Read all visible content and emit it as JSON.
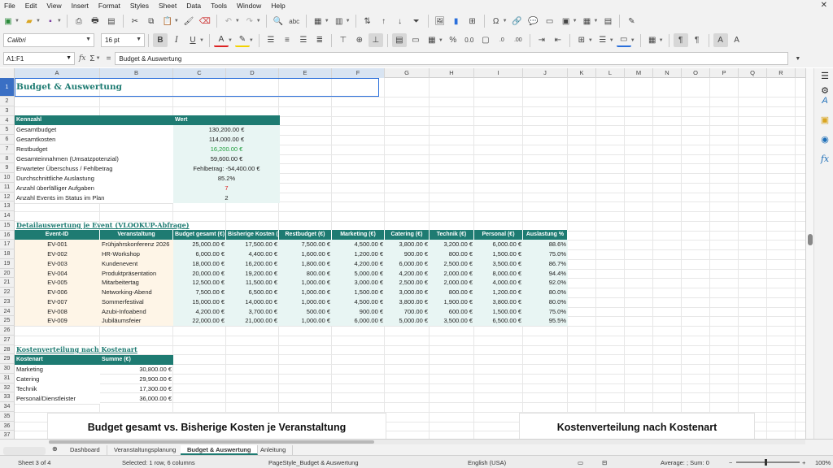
{
  "menu": [
    "File",
    "Edit",
    "View",
    "Insert",
    "Format",
    "Styles",
    "Sheet",
    "Data",
    "Tools",
    "Window",
    "Help"
  ],
  "font_name": "Calibri",
  "font_size": "16 pt",
  "name_box": "A1:F1",
  "formula": "Budget & Auswertung",
  "columns": [
    "A",
    "B",
    "C",
    "D",
    "E",
    "F",
    "G",
    "H",
    "I",
    "J",
    "K",
    "L",
    "M",
    "N",
    "O",
    "P",
    "Q",
    "R"
  ],
  "rows": [
    "1",
    "2",
    "3",
    "4",
    "5",
    "6",
    "7",
    "8",
    "9",
    "10",
    "11",
    "12",
    "13",
    "14",
    "15",
    "16",
    "17",
    "18",
    "19",
    "20",
    "21",
    "22",
    "23",
    "24",
    "25",
    "26",
    "27",
    "28",
    "29",
    "30",
    "31",
    "32",
    "33",
    "34",
    "35",
    "36",
    "37"
  ],
  "title": "Budget & Auswertung",
  "kpi": {
    "header": [
      "Kennzahl",
      "Wert"
    ],
    "rows": [
      {
        "label": "Gesamtbudget",
        "value": "130,200.00 €"
      },
      {
        "label": "Gesamtkosten",
        "value": "114,000.00 €"
      },
      {
        "label": "Restbudget",
        "value": "16,200.00 €"
      },
      {
        "label": "Gesamteinnahmen (Umsatzpotenzial)",
        "value": "59,600.00 €"
      },
      {
        "label": "Erwarteter Überschuss / Fehlbetrag",
        "value": "Fehlbetrag: -54,400.00 €"
      },
      {
        "label": "Durchschnittliche Auslastung",
        "value": "85.2%"
      },
      {
        "label": "Anzahl überfälliger Aufgaben",
        "value": "7"
      },
      {
        "label": "Anzahl Events im Status im Plan",
        "value": "2"
      }
    ]
  },
  "detail": {
    "title": "Detailauswertung je Event (VLOOKUP-Abfrage)",
    "header": [
      "Event-ID",
      "Veranstaltung",
      "Budget gesamt (€)",
      "Bisherige Kosten (",
      "Restbudget (€)",
      "Marketing (€)",
      "Catering (€)",
      "Technik (€)",
      "Personal (€)",
      "Auslastung %"
    ],
    "rows": [
      [
        "EV-001",
        "Frühjahrskonferenz 2026",
        "25,000.00 €",
        "17,500.00 €",
        "7,500.00 €",
        "4,500.00 €",
        "3,800.00 €",
        "3,200.00 €",
        "6,000.00 €",
        "88.6%"
      ],
      [
        "EV-002",
        "HR-Workshop",
        "6,000.00 €",
        "4,400.00 €",
        "1,600.00 €",
        "1,200.00 €",
        "900.00 €",
        "800.00 €",
        "1,500.00 €",
        "75.0%"
      ],
      [
        "EV-003",
        "Kundenevent",
        "18,000.00 €",
        "16,200.00 €",
        "1,800.00 €",
        "4,200.00 €",
        "6,000.00 €",
        "2,500.00 €",
        "3,500.00 €",
        "86.7%"
      ],
      [
        "EV-004",
        "Produktpräsentation",
        "20,000.00 €",
        "19,200.00 €",
        "800.00 €",
        "5,000.00 €",
        "4,200.00 €",
        "2,000.00 €",
        "8,000.00 €",
        "94.4%"
      ],
      [
        "EV-005",
        "Mitarbeitertag",
        "12,500.00 €",
        "11,500.00 €",
        "1,000.00 €",
        "3,000.00 €",
        "2,500.00 €",
        "2,000.00 €",
        "4,000.00 €",
        "92.0%"
      ],
      [
        "EV-006",
        "Networking-Abend",
        "7,500.00 €",
        "6,500.00 €",
        "1,000.00 €",
        "1,500.00 €",
        "3,000.00 €",
        "800.00 €",
        "1,200.00 €",
        "80.0%"
      ],
      [
        "EV-007",
        "Sommerfestival",
        "15,000.00 €",
        "14,000.00 €",
        "1,000.00 €",
        "4,500.00 €",
        "3,800.00 €",
        "1,900.00 €",
        "3,800.00 €",
        "80.0%"
      ],
      [
        "EV-008",
        "Azubi-Infoabend",
        "4,200.00 €",
        "3,700.00 €",
        "500.00 €",
        "900.00 €",
        "700.00 €",
        "600.00 €",
        "1,500.00 €",
        "75.0%"
      ],
      [
        "EV-009",
        "Jubiläumsfeier",
        "22,000.00 €",
        "21,000.00 €",
        "1,000.00 €",
        "6,000.00 €",
        "5,000.00 €",
        "3,500.00 €",
        "6,500.00 €",
        "95.5%"
      ]
    ]
  },
  "cost": {
    "title": "Kostenverteilung nach Kostenart",
    "header": [
      "Kostenart",
      "Summe (€)"
    ],
    "rows": [
      [
        "Marketing",
        "30,800.00 €"
      ],
      [
        "Catering",
        "29,900.00 €"
      ],
      [
        "Technik",
        "17,300.00 €"
      ],
      [
        "Personal/Dienstleister",
        "36,000.00 €"
      ]
    ]
  },
  "charts": {
    "left_title": "Budget gesamt vs. Bisherige Kosten je Veranstaltung",
    "right_title": "Kostenverteilung nach Kostenart"
  },
  "tabs": [
    "Dashboard",
    "Veranstaltungsplanung",
    "Budget & Auswertung",
    "Anleitung"
  ],
  "active_tab": "Budget & Auswertung",
  "status": {
    "sheet": "Sheet 3 of 4",
    "selection": "Selected: 1 row, 6 columns",
    "page_style": "PageStyle_Budget & Auswertung",
    "language": "English (USA)",
    "sum": "Average: ; Sum: 0",
    "zoom": "100%"
  },
  "colors": {
    "accent": "#1e7b72",
    "band_a": "#fef5e7",
    "band_b": "#e8f5f3",
    "selection": "#2a6fdb"
  }
}
